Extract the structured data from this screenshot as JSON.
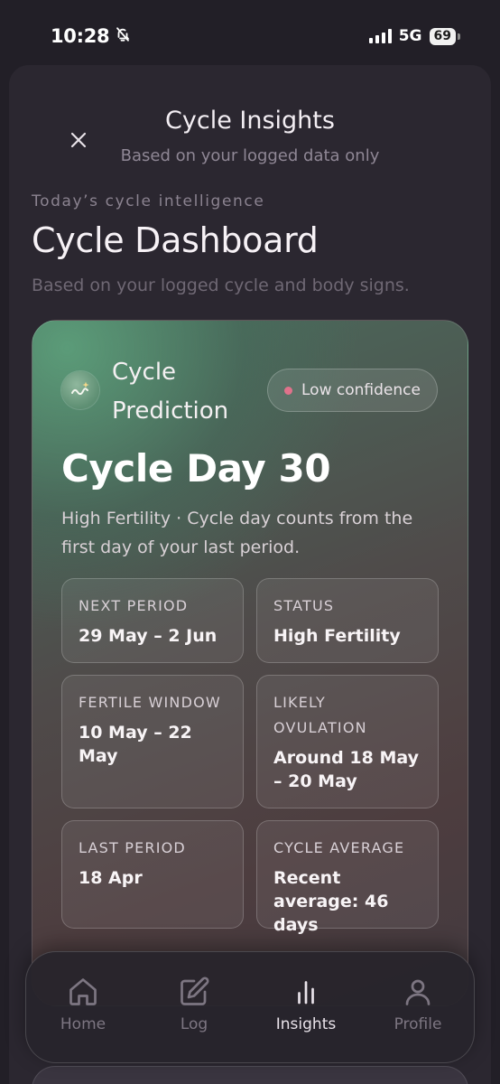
{
  "status_bar": {
    "time": "10:28",
    "network": "5G",
    "battery": "69"
  },
  "header": {
    "title": "Cycle Insights",
    "subtitle": "Based on your logged data only"
  },
  "dashboard": {
    "eyebrow": "Today’s cycle intelligence",
    "title": "Cycle Dashboard",
    "subtitle": "Based on your logged cycle and body signs."
  },
  "prediction_card": {
    "label": "Cycle Prediction",
    "confidence": "Low confidence",
    "cycle_day": "Cycle Day 30",
    "description": "High Fertility · Cycle day counts from the first day of your last period.",
    "tiles": [
      {
        "label": "NEXT PERIOD",
        "value": "29 May – 2 Jun"
      },
      {
        "label": "STATUS",
        "value": "High Fertility"
      },
      {
        "label": "FERTILE WINDOW",
        "value": "10 May – 22 May"
      },
      {
        "label": "LIKELY OVULATION",
        "value": "Around 18 May – 20 May"
      },
      {
        "label": "LAST PERIOD",
        "value": "18 Apr"
      },
      {
        "label": "CYCLE AVERAGE",
        "value": "Recent average: 46 days"
      }
    ]
  },
  "tabbar": {
    "items": [
      {
        "label": "Home",
        "icon": "home-icon"
      },
      {
        "label": "Log",
        "icon": "edit-icon"
      },
      {
        "label": "Insights",
        "icon": "bar-chart-icon",
        "active": true
      },
      {
        "label": "Profile",
        "icon": "user-icon"
      }
    ]
  },
  "colors": {
    "background": "#221f27",
    "sheet": "#2b2730",
    "accent_green": "#5c9e7a",
    "confidence_dot": "#e0728b"
  }
}
